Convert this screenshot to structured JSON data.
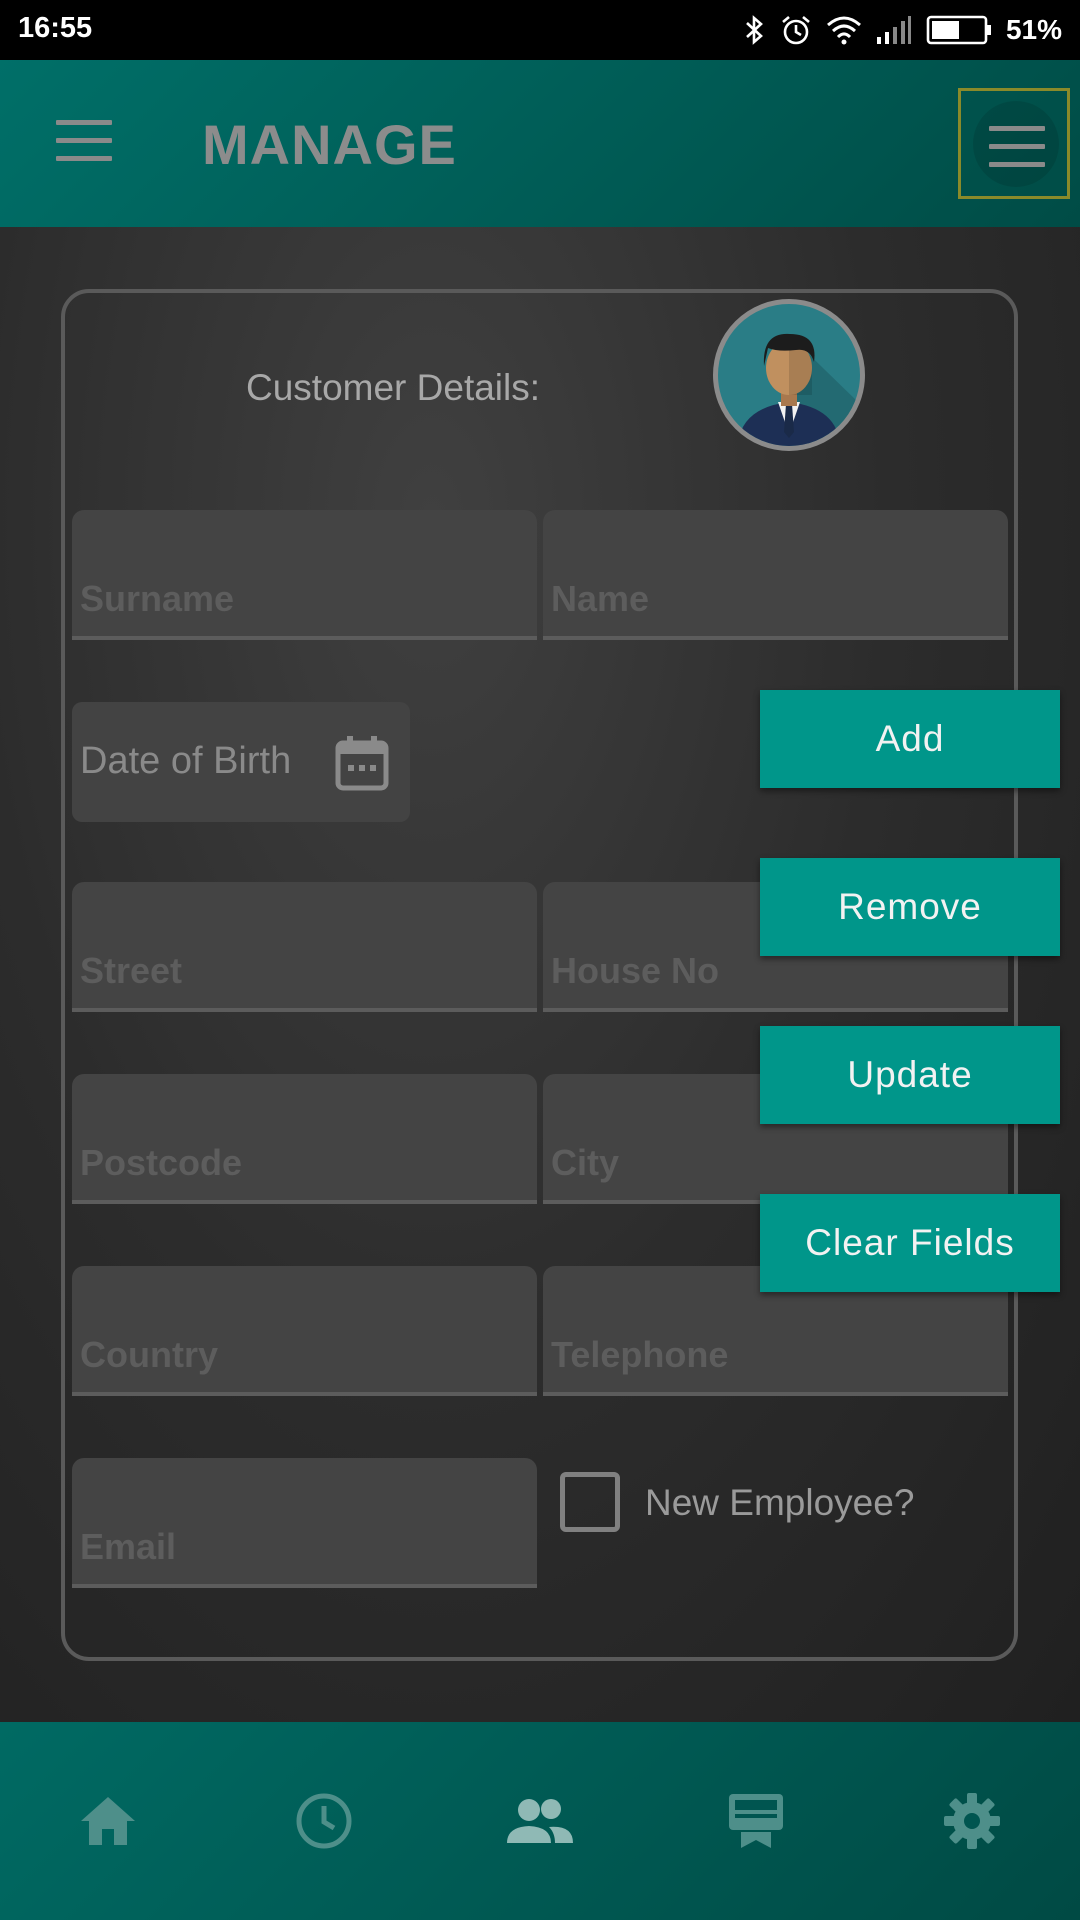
{
  "status_bar": {
    "time": "16:55",
    "battery_percent": "51%",
    "icons": [
      "bluetooth-icon",
      "alarm-icon",
      "wifi-icon",
      "signal-icon",
      "battery-icon"
    ]
  },
  "app_bar": {
    "title": "MANAGE",
    "left_icon": "menu-icon",
    "right_icon": "menu-icon"
  },
  "form": {
    "label": "Customer Details:",
    "avatar_icon": "person-avatar-icon",
    "fields": {
      "surname": "Surname",
      "name": "Name",
      "street": "Street",
      "house_no": "House No",
      "postcode": "Postcode",
      "city": "City",
      "country": "Country",
      "telephone": "Telephone",
      "email": "Email"
    },
    "dob_label": "Date of Birth",
    "new_employee_label": "New Employee?",
    "new_employee_checked": false
  },
  "buttons": {
    "add": "Add",
    "remove": "Remove",
    "update": "Update",
    "clear": "Clear Fields"
  },
  "bottom_nav": {
    "items": [
      "home-icon",
      "clock-icon",
      "people-icon",
      "receipt-icon",
      "settings-icon"
    ],
    "active": "people-icon"
  },
  "colors": {
    "primary": "#00968a",
    "app_bar": "#005a54",
    "card_border": "#5a5a5a"
  }
}
